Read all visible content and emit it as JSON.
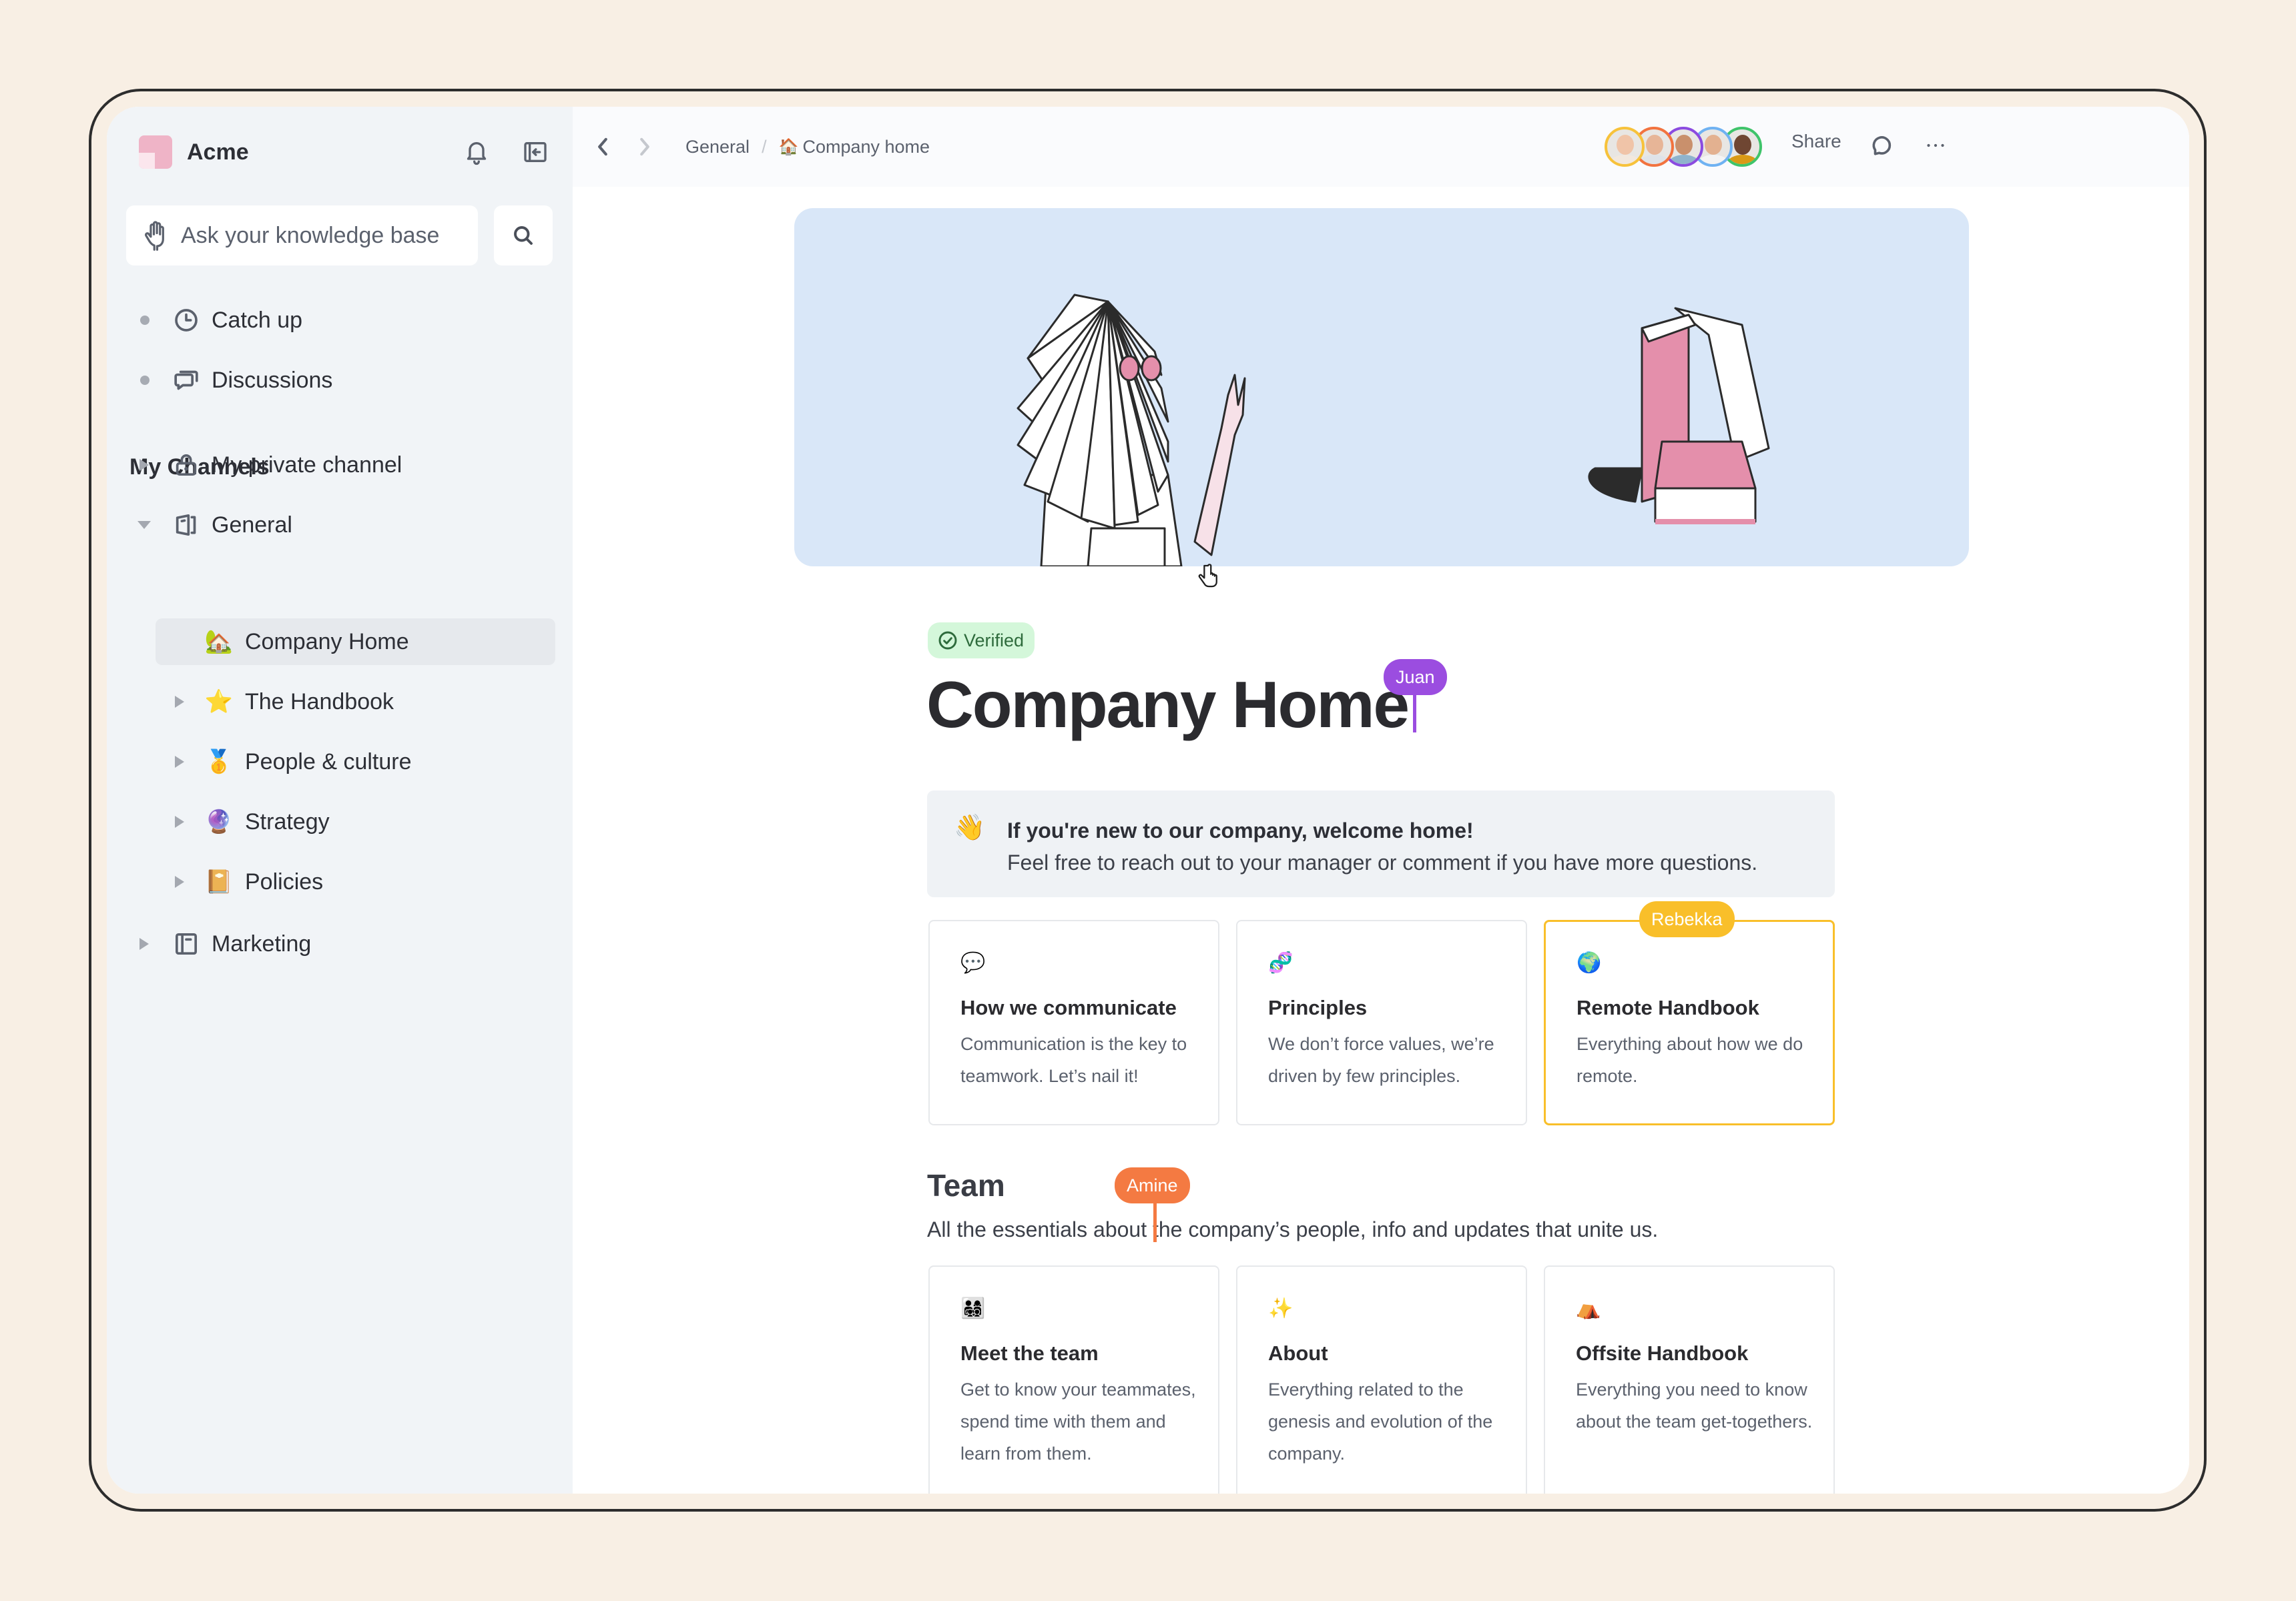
{
  "sidebar": {
    "workspace_name": "Acme",
    "search": {
      "placeholder": "Ask your knowledge base"
    },
    "nav": [
      {
        "label": "Catch up",
        "icon": "clock-icon"
      },
      {
        "label": "Discussions",
        "icon": "chat-bubbles-icon"
      }
    ],
    "section_title": "My Channels",
    "channels": [
      {
        "label": "My private channel",
        "icon": "lock-icon",
        "expanded": false
      },
      {
        "label": "General",
        "icon": "door-icon",
        "expanded": true
      },
      {
        "label": "Company Home",
        "emoji": "🏡",
        "active": true
      },
      {
        "label": "The Handbook",
        "emoji": "⭐"
      },
      {
        "label": "People & culture",
        "emoji": "🥇"
      },
      {
        "label": "Strategy",
        "emoji": "🔮"
      },
      {
        "label": "Policies",
        "emoji": "📔"
      },
      {
        "label": "Marketing",
        "icon": "board-icon",
        "expanded": false
      }
    ]
  },
  "topbar": {
    "breadcrumb": [
      {
        "label": "General"
      },
      {
        "label": "Company home",
        "emoji": "🏠"
      }
    ],
    "share_label": "Share",
    "collaborators": [
      {
        "ring": "#f7c23b",
        "skin": "#f0c4a8",
        "shirt": "#f2e8de"
      },
      {
        "ring": "#f2733f",
        "skin": "#e7b597",
        "shirt": "#dfe3e8"
      },
      {
        "ring": "#8b4be0",
        "skin": "#c9906c",
        "shirt": "#8fb3cc"
      },
      {
        "ring": "#6fb2f2",
        "skin": "#e3b190",
        "shirt": "#f4f4f4"
      },
      {
        "ring": "#3fc46a",
        "skin": "#6f4632",
        "shirt": "#d99a16"
      }
    ]
  },
  "page": {
    "verified_label": "Verified",
    "title": "Company Home",
    "callout": {
      "emoji": "👋",
      "title": "If you're new to our company, welcome home!",
      "body": "Feel free to reach out to your manager or comment if you have more questions."
    },
    "cards_row1": [
      {
        "emoji": "💬",
        "title": "How we communicate",
        "desc": "Communication is the key to teamwork. Let’s nail it!"
      },
      {
        "emoji": "🧬",
        "title": "Principles",
        "desc": "We don’t force values, we’re driven by few principles."
      },
      {
        "emoji": "🌍",
        "title": "Remote Handbook",
        "desc": "Everything about how we do remote."
      }
    ],
    "team_heading": "Team",
    "team_desc": "All the essentials about the company’s people, info and updates that unite us.",
    "cards_row2": [
      {
        "emoji": "👨‍👩‍👧‍👦",
        "title": "Meet the team",
        "desc": "Get to know your teammates, spend time with them and learn from them."
      },
      {
        "emoji": "✨",
        "title": "About",
        "desc": "Everything related to the genesis and evolution of the company."
      },
      {
        "emoji": "⛺",
        "title": "Offsite Handbook",
        "desc": "Everything you need to know about the team get-togethers."
      }
    ]
  },
  "presence": [
    {
      "name": "Juan",
      "color": "#9b4de0"
    },
    {
      "name": "Rebekka",
      "color": "#f9bf2a"
    },
    {
      "name": "Amine",
      "color": "#f47a42"
    }
  ],
  "colors": {
    "background": "#f8efe4",
    "sidebar": "#f1f4f7",
    "cover": "#d9e7f8",
    "verified_bg": "#d4f7da",
    "accent_pink": "#e48fab"
  }
}
